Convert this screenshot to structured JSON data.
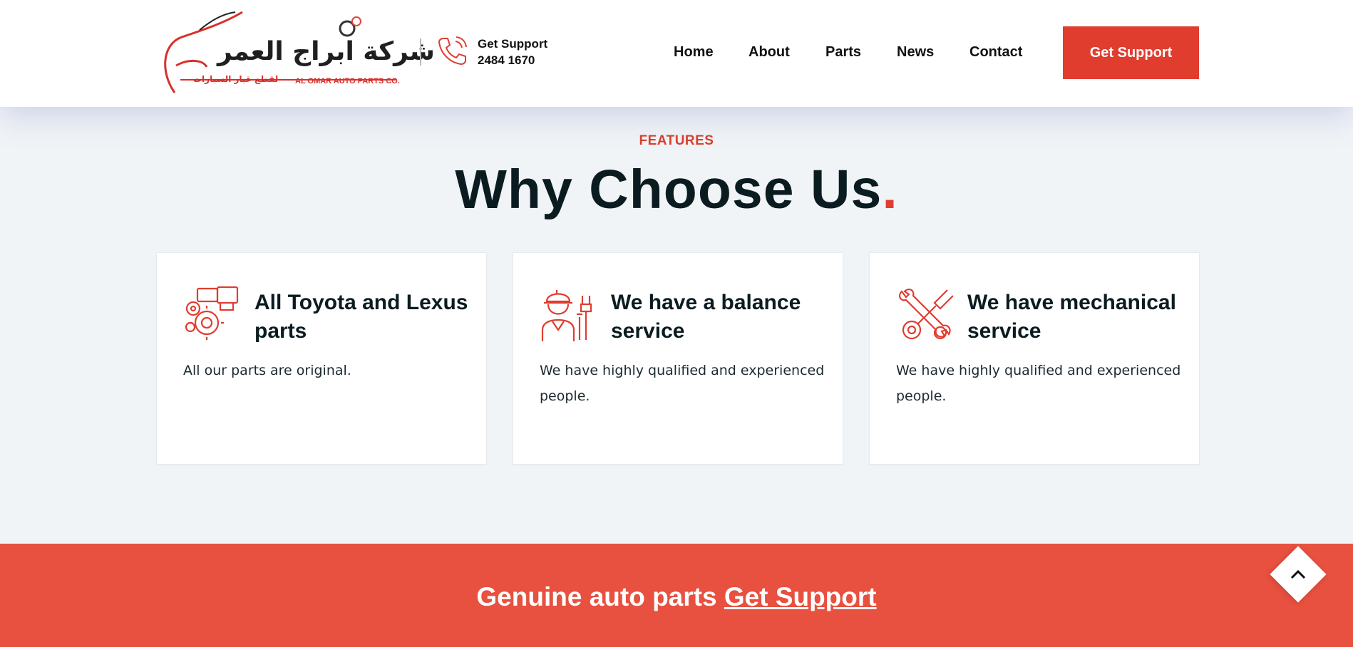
{
  "header": {
    "logo": {
      "arabic_name": "شركة ابراج العمر",
      "arabic_tagline": "لقطع غيار السيارات",
      "english_name": "AL OMAR AUTO PARTS CO."
    },
    "support": {
      "label": "Get Support",
      "number": "2484 1670",
      "icon": "phone-icon"
    },
    "nav": [
      {
        "label": "Home"
      },
      {
        "label": "About"
      },
      {
        "label": "Parts"
      },
      {
        "label": "News"
      },
      {
        "label": "Contact"
      }
    ],
    "cta_label": "Get Support"
  },
  "features": {
    "eyebrow": "FEATURES",
    "title": "Why Choose Us",
    "title_dot": ".",
    "cards": [
      {
        "icon": "engine-gears-icon",
        "title": "All Toyota and Lexus parts",
        "text": "All our parts are original."
      },
      {
        "icon": "mechanic-worker-icon",
        "title": "We have a balance service",
        "text": "We have highly qualified and experienced people."
      },
      {
        "icon": "crossed-tools-icon",
        "title": "We have mechanical service",
        "text": "We have highly qualified and experienced people."
      }
    ]
  },
  "banner": {
    "text": "Genuine auto parts",
    "link_label": "Get Support"
  },
  "scroll_top_icon": "chevron-up-icon",
  "colors": {
    "accent": "#e03d2f",
    "banner": "#e8503f",
    "heading": "#0b1c21",
    "page_bg": "#f1f4f6"
  }
}
